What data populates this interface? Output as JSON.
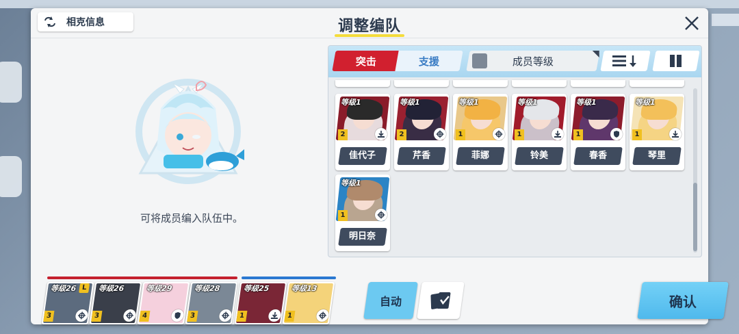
{
  "header": {
    "info_label": "相克信息",
    "title": "调整编队"
  },
  "empty_state": {
    "text": "可将成员编入队伍中。"
  },
  "roster": {
    "tabs": [
      {
        "label": "突击",
        "active": true
      },
      {
        "label": "支援",
        "active": false
      }
    ],
    "filter_label": "成员等级",
    "members": [
      {
        "level": "等级1",
        "name": "佳代子",
        "star": "2",
        "role": "download",
        "hair": "#2a2a2a",
        "hair2": "#f1f1f1",
        "bg": "#8a1c2a"
      },
      {
        "level": "等级1",
        "name": "芹香",
        "star": "2",
        "role": "target",
        "hair": "#222236",
        "hair2": "#2f2f48",
        "bg": "#9a2030"
      },
      {
        "level": "等级1",
        "name": "菲娜",
        "star": "1",
        "role": "target",
        "hair": "#f2b244",
        "hair2": "#f7c766",
        "bg": "#e9c88a"
      },
      {
        "level": "等级1",
        "name": "铃美",
        "star": "1",
        "role": "download",
        "hair": "#e4e6ea",
        "hair2": "#cfd3da",
        "bg": "#a11b2b"
      },
      {
        "level": "等级1",
        "name": "春香",
        "star": "1",
        "role": "shield",
        "hair": "#3a2a4a",
        "hair2": "#5a3b72",
        "bg": "#8d1c2c"
      },
      {
        "level": "等级1",
        "name": "琴里",
        "star": "1",
        "role": "download",
        "hair": "#f3c05a",
        "hair2": "#f5d27e",
        "bg": "#f5e3b6"
      },
      {
        "level": "等级1",
        "name": "明日奈",
        "star": "1",
        "role": "target",
        "hair": "#b08a6c",
        "hair2": "#c9a88a",
        "bg": "#2b84c5"
      }
    ]
  },
  "team": {
    "striker_color": "#c4202e",
    "special_color": "#2a78d1",
    "strikers": [
      {
        "level": "等级26",
        "star": "3",
        "role": "target",
        "leader": "L",
        "hair": "#b9bcc4",
        "bg": "#5c6b7e"
      },
      {
        "level": "等级26",
        "star": "3",
        "role": "target",
        "leader": "",
        "hair": "#c8c8c8",
        "bg": "#3a3f4a"
      },
      {
        "level": "等级29",
        "star": "4",
        "role": "shield",
        "leader": "",
        "hair": "#f3a9be",
        "bg": "#f5d0dd"
      },
      {
        "level": "等级28",
        "star": "3",
        "role": "target",
        "leader": "",
        "hair": "#cfd4dc",
        "bg": "#7b8896"
      }
    ],
    "specials": [
      {
        "level": "等级25",
        "star": "1",
        "role": "download",
        "leader": "",
        "hair": "#e8dcc0",
        "bg": "#7a2636"
      },
      {
        "level": "等级13",
        "star": "1",
        "role": "target",
        "leader": "",
        "hair": "#f2b93e",
        "bg": "#f4d37a"
      }
    ]
  },
  "buttons": {
    "auto": "自动",
    "confirm": "确认"
  },
  "colors": {
    "accent_red": "#d1202f",
    "accent_blue": "#6cc9f1",
    "title_underline": "#f4dc3b"
  }
}
